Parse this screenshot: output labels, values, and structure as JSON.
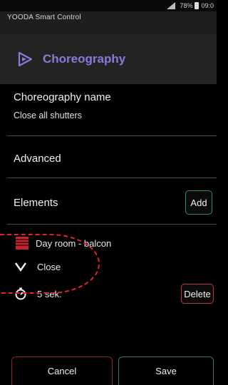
{
  "status": {
    "battery": "78%",
    "time": "09:0"
  },
  "app_title": "YOODA Smart Control",
  "header": {
    "title": "Choreography"
  },
  "name_field": {
    "label": "Choreography name",
    "value": "Close all shutters"
  },
  "advanced": {
    "label": "Advanced"
  },
  "elements": {
    "label": "Elements",
    "add_label": "Add",
    "items": [
      {
        "name": "Day room - balcon",
        "action": "Close",
        "delay": "5  sek."
      }
    ],
    "delete_label": "Delete"
  },
  "footer": {
    "cancel_label": "Cancel",
    "save_label": "Save"
  },
  "colors": {
    "accent": "#8a7bd8",
    "add_border": "#2e8b6f",
    "delete_border": "#b13a3a",
    "annotation": "#e3242b"
  }
}
